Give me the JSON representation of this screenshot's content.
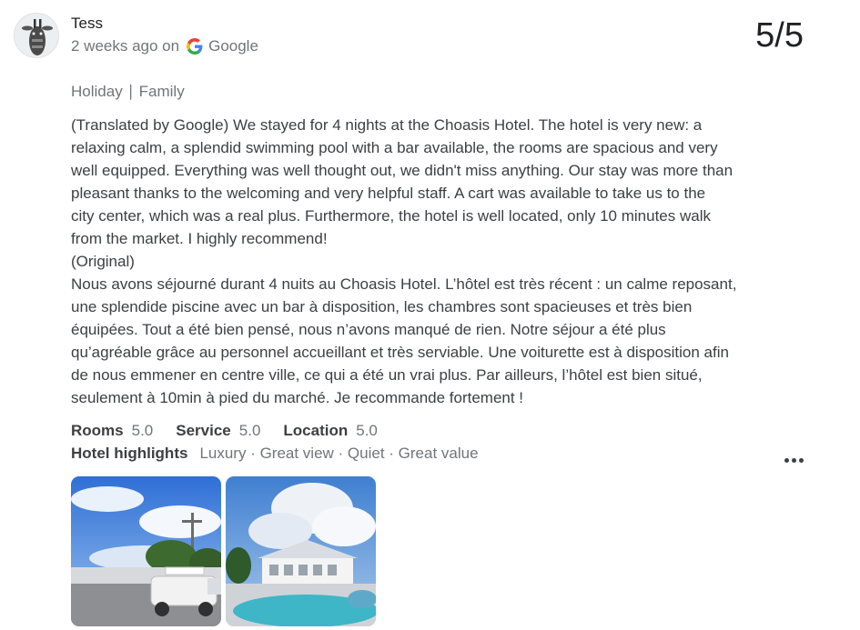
{
  "review": {
    "author": "Tess",
    "date": "2 weeks ago on",
    "source": "Google",
    "score": "5/5",
    "trip_type": "Holiday ∣ Family",
    "text_lines": [
      "(Translated by Google) We stayed for 4 nights at the Choasis Hotel. The hotel is very new: a",
      "relaxing calm, a splendid swimming pool with a bar available, the rooms are spacious and very",
      "well equipped. Everything was well thought out, we didn't miss anything. Our stay was more than",
      "pleasant thanks to the welcoming and very helpful staff. A cart was available to take us to the",
      "city center, which was a real plus. Furthermore, the hotel is well located, only 10 minutes walk",
      "from the market. I highly recommend!",
      "(Original)",
      "Nous avons séjourné durant 4 nuits au Choasis Hotel. L’hôtel est très récent : un calme reposant,",
      "une splendide piscine avec un bar à disposition, les chambres sont spacieuses et très bien",
      "équipées. Tout a été bien pensé, nous n’avons manqué de rien. Notre séjour a été plus",
      "qu’agréable grâce au personnel accueillant et très serviable. Une voiturette est à disposition afin",
      "de nous emmener en centre ville, ce qui a été un vrai plus. Par ailleurs, l’hôtel est bien situé,",
      "seulement à 10min à pied du marché. Je recommande fortement !"
    ],
    "ratings": [
      {
        "label": "Rooms",
        "value": "5.0"
      },
      {
        "label": "Service",
        "value": "5.0"
      },
      {
        "label": "Location",
        "value": "5.0"
      }
    ],
    "highlights_label": "Hotel highlights",
    "highlights": "Luxury · Great view · Quiet · Great value"
  },
  "icons": {
    "avatar": "giraffe-avatar",
    "source": "google-g-icon",
    "more": "more-horizontal-icon"
  },
  "colors": {
    "text": "#202124",
    "secondary": "#70757a",
    "body": "#3c4043"
  }
}
